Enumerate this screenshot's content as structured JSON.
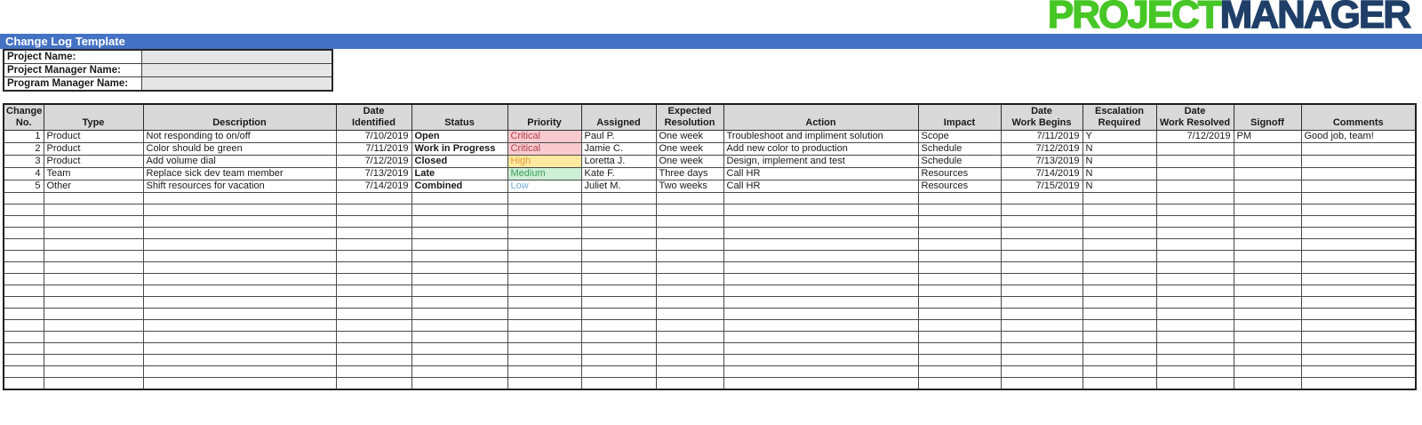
{
  "logo": {
    "part1": "PROJECT",
    "part2": "MANAGER",
    "green": "#46C726",
    "navy": "#1F3F69"
  },
  "title_bar": {
    "text": "Change Log Template",
    "bg": "#4472C4"
  },
  "info_fields": [
    {
      "label": "Project Name:",
      "value": ""
    },
    {
      "label": "Project Manager Name:",
      "value": ""
    },
    {
      "label": "Program Manager Name:",
      "value": ""
    }
  ],
  "table": {
    "headers": [
      "Change\nNo.",
      "Type",
      "Description",
      "Date\nIdentified",
      "Status",
      "Priority",
      "Assigned",
      "Expected\nResolution",
      "Action",
      "Impact",
      "Date\nWork Begins",
      "Escalation\nRequired",
      "Date\nWork Resolved",
      "Signoff",
      "Comments"
    ],
    "rows": [
      {
        "no": "1",
        "type": "Product",
        "description": "Not responding to on/off",
        "date_identified": "7/10/2019",
        "status": "Open",
        "priority": "Critical",
        "assigned": "Paul P.",
        "expected_resolution": "One week",
        "action": "Troubleshoot and impliment solution",
        "impact": "Scope",
        "date_work_begins": "7/11/2019",
        "escalation_required": "Y",
        "date_work_resolved": "7/12/2019",
        "signoff": "PM",
        "comments": "Good job, team!"
      },
      {
        "no": "2",
        "type": "Product",
        "description": "Color should be green",
        "date_identified": "7/11/2019",
        "status": "Work in Progress",
        "priority": "Critical",
        "assigned": "Jamie C.",
        "expected_resolution": "One week",
        "action": "Add new color to production",
        "impact": "Schedule",
        "date_work_begins": "7/12/2019",
        "escalation_required": "N",
        "date_work_resolved": "",
        "signoff": "",
        "comments": ""
      },
      {
        "no": "3",
        "type": "Product",
        "description": "Add volume dial",
        "date_identified": "7/12/2019",
        "status": "Closed",
        "priority": "High",
        "assigned": "Loretta J.",
        "expected_resolution": "One week",
        "action": "Design, implement and test",
        "impact": "Schedule",
        "date_work_begins": "7/13/2019",
        "escalation_required": "N",
        "date_work_resolved": "",
        "signoff": "",
        "comments": ""
      },
      {
        "no": "4",
        "type": "Team",
        "description": "Replace sick dev team member",
        "date_identified": "7/13/2019",
        "status": "Late",
        "priority": "Medium",
        "assigned": "Kate F.",
        "expected_resolution": "Three days",
        "action": "Call HR",
        "impact": "Resources",
        "date_work_begins": "7/14/2019",
        "escalation_required": "N",
        "date_work_resolved": "",
        "signoff": "",
        "comments": ""
      },
      {
        "no": "5",
        "type": "Other",
        "description": "Shift resources for vacation",
        "date_identified": "7/14/2019",
        "status": "Combined",
        "priority": "Low",
        "assigned": "Juliet M.",
        "expected_resolution": "Two weeks",
        "action": "Call HR",
        "impact": "Resources",
        "date_work_begins": "7/15/2019",
        "escalation_required": "N",
        "date_work_resolved": "",
        "signoff": "",
        "comments": ""
      }
    ],
    "empty_row_count": 17,
    "priority_styles": {
      "Critical": {
        "bg": "#F8CACF",
        "color": "#B2404B"
      },
      "High": {
        "bg": "#FFE9A0",
        "color": "#DFA13D"
      },
      "Medium": {
        "bg": "#CCEFD6",
        "color": "#3FA05C"
      },
      "Low": {
        "bg": "",
        "color": "#74AADC"
      }
    }
  }
}
